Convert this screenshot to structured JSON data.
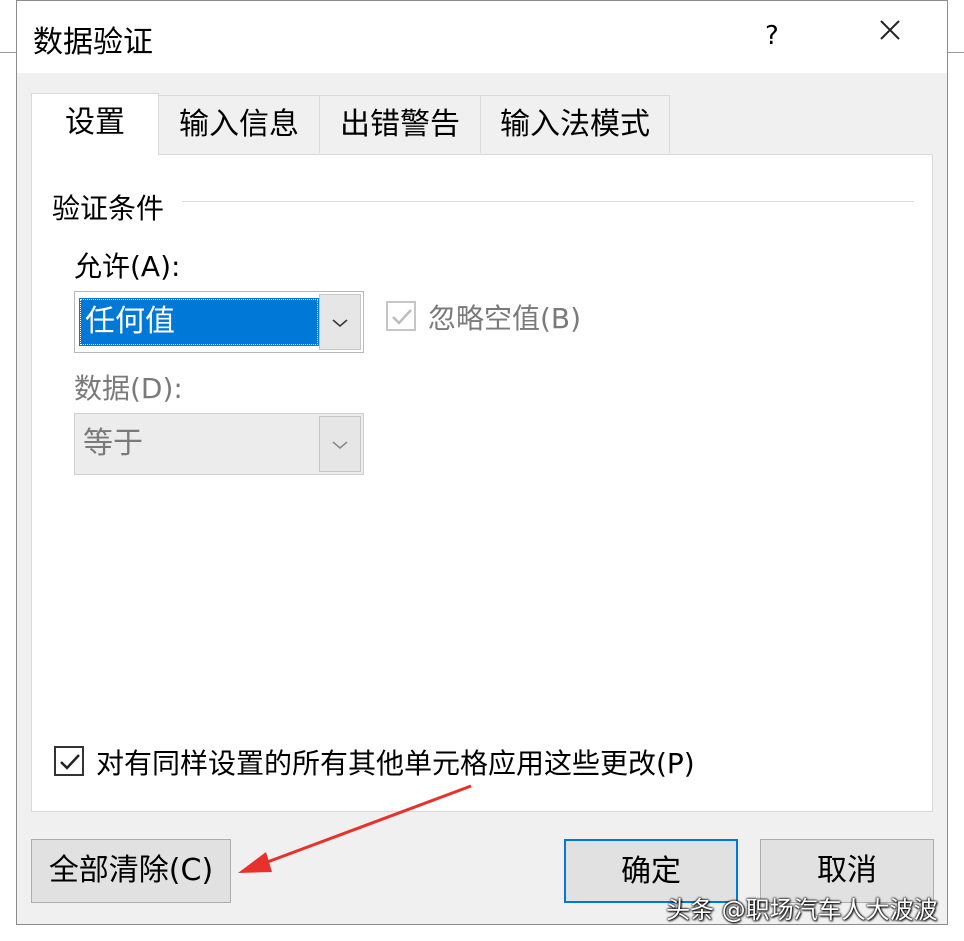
{
  "dialog": {
    "title": "数据验证",
    "help_label": "?",
    "close_icon": "close-icon"
  },
  "tabs": [
    {
      "label": "设置",
      "active": true
    },
    {
      "label": "输入信息",
      "active": false
    },
    {
      "label": "出错警告",
      "active": false
    },
    {
      "label": "输入法模式",
      "active": false
    }
  ],
  "settings": {
    "section_label": "验证条件",
    "allow_label": "允许(A):",
    "allow_value": "任何值",
    "ignore_blank_label": "忽略空值(B)",
    "ignore_blank_checked": true,
    "ignore_blank_enabled": false,
    "data_label": "数据(D):",
    "data_value": "等于",
    "data_enabled": false,
    "apply_all_label": "对有同样设置的所有其他单元格应用这些更改(P)",
    "apply_all_checked": true
  },
  "buttons": {
    "clear_all": "全部清除(C)",
    "ok": "确定",
    "cancel": "取消"
  },
  "annotation": {
    "arrow_color": "#e8312a",
    "points_to": "clear-all-button"
  },
  "watermark": "头条 @职场汽车人大波波",
  "colors": {
    "accent": "#0078d7",
    "dialog_bg": "#f0f0f0",
    "panel_bg": "#ffffff"
  }
}
